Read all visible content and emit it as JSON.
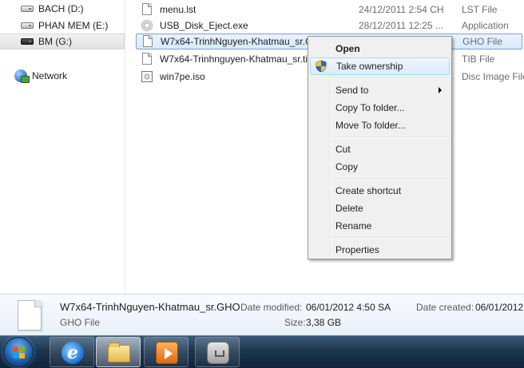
{
  "nav": {
    "drives": [
      {
        "label": "BACH (D:)",
        "icon": "hard-drive-icon"
      },
      {
        "label": "PHAN MEM (E:)",
        "icon": "hard-drive-icon"
      },
      {
        "label": "BM (G:)",
        "icon": "usb-drive-icon",
        "selected": true
      }
    ],
    "network": {
      "label": "Network",
      "icon": "network-icon"
    }
  },
  "files": [
    {
      "name": "menu.lst",
      "date": "24/12/2011 2:54 CH",
      "type": "LST File",
      "icon": "document-icon"
    },
    {
      "name": "USB_Disk_Eject.exe",
      "date": "28/12/2011 12:25 ...",
      "type": "Application",
      "icon": "application-icon"
    },
    {
      "name": "W7x64-TrinhNguyen-Khatmau_sr.GHO",
      "date": "",
      "type": "GHO File",
      "icon": "document-icon",
      "selected": true
    },
    {
      "name": "W7x64-Trinhnguyen-Khatmau_sr.tib",
      "date": "",
      "type": "TIB File",
      "icon": "document-icon"
    },
    {
      "name": "win7pe.iso",
      "date": "",
      "type": "Disc Image File",
      "icon": "disc-image-icon"
    }
  ],
  "context_menu": {
    "items": {
      "open": "Open",
      "take_ownership": "Take ownership",
      "send_to": "Send to",
      "copy_to_folder": "Copy To folder...",
      "move_to_folder": "Move To folder...",
      "cut": "Cut",
      "copy": "Copy",
      "create_shortcut": "Create shortcut",
      "delete": "Delete",
      "rename": "Rename",
      "properties": "Properties"
    }
  },
  "details": {
    "name": "W7x64-TrinhNguyen-Khatmau_sr.GHO",
    "type": "GHO File",
    "date_modified_label": "Date modified:",
    "date_modified": "06/01/2012 4:50 SA",
    "date_created_label": "Date created:",
    "date_created": "06/01/2012",
    "size_label": "Size:",
    "size": "3,38 GB"
  },
  "taskbar": {
    "buttons": [
      {
        "icon": "internet-explorer-icon"
      },
      {
        "icon": "windows-explorer-icon",
        "active": true
      },
      {
        "icon": "media-player-icon"
      },
      {
        "icon": "usb-device-icon"
      }
    ]
  },
  "colors": {
    "selection_fill": "#d7e9fb",
    "selection_border": "#7da2ce",
    "menu_highlight": "#dcebfc",
    "taskbar": "#1d3650"
  }
}
